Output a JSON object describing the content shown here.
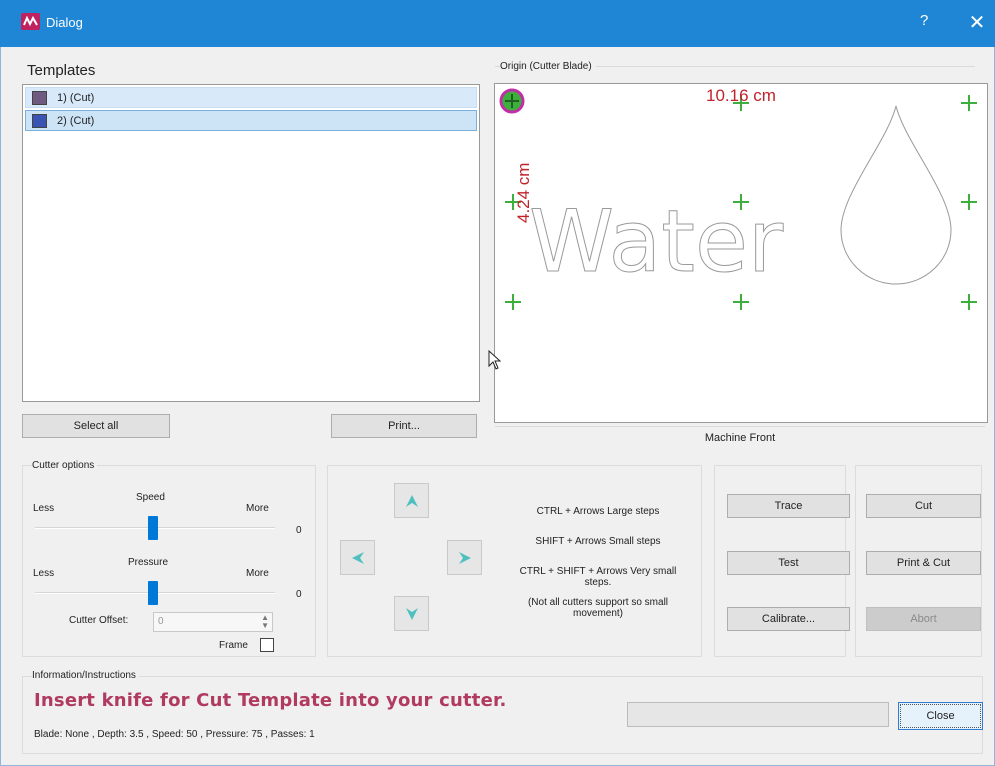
{
  "window": {
    "title": "Dialog",
    "help_label": "?",
    "close_label": "✕"
  },
  "templates": {
    "heading": "Templates",
    "items": [
      {
        "label": "1) (Cut)",
        "color": "#6f5a82"
      },
      {
        "label": "2) (Cut)",
        "color": "#3a54b4"
      }
    ],
    "select_all_label": "Select all",
    "print_label": "Print..."
  },
  "origin": {
    "heading": "Origin (Cutter Blade)",
    "width_label": "10.16 cm",
    "height_label": "4.24 cm",
    "artwork_text": "Water",
    "machine_front_label": "Machine Front",
    "origin_marker_color": "#c02fa6",
    "marker_color": "#3daf3d",
    "dimension_color": "#c0232b"
  },
  "cutter_options": {
    "heading": "Cutter options",
    "speed": {
      "label": "Speed",
      "less": "Less",
      "more": "More",
      "value": "0"
    },
    "pressure": {
      "label": "Pressure",
      "less": "Less",
      "more": "More",
      "value": "0"
    },
    "offset": {
      "label": "Cutter Offset:",
      "value": "0"
    },
    "frame_label": "Frame"
  },
  "movement": {
    "hint_large": "CTRL + Arrows  Large steps",
    "hint_small": "SHIFT + Arrows  Small steps",
    "hint_very_small": "CTRL + SHIFT + Arrows  Very small steps.",
    "hint_note": "(Not all cutters support so small movement)",
    "arrow_color": "#4fc0c0"
  },
  "actions": {
    "trace_label": "Trace",
    "test_label": "Test",
    "calibrate_label": "Calibrate...",
    "cut_label": "Cut",
    "print_cut_label": "Print & Cut",
    "abort_label": "Abort"
  },
  "info": {
    "heading": "Information/Instructions",
    "instruction": "Insert knife for Cut Template into your cutter.",
    "blade_info": "Blade: None ,  Depth:  3.5 , Speed: 50 , Pressure: 75 , Passes: 1",
    "close_label": "Close"
  }
}
